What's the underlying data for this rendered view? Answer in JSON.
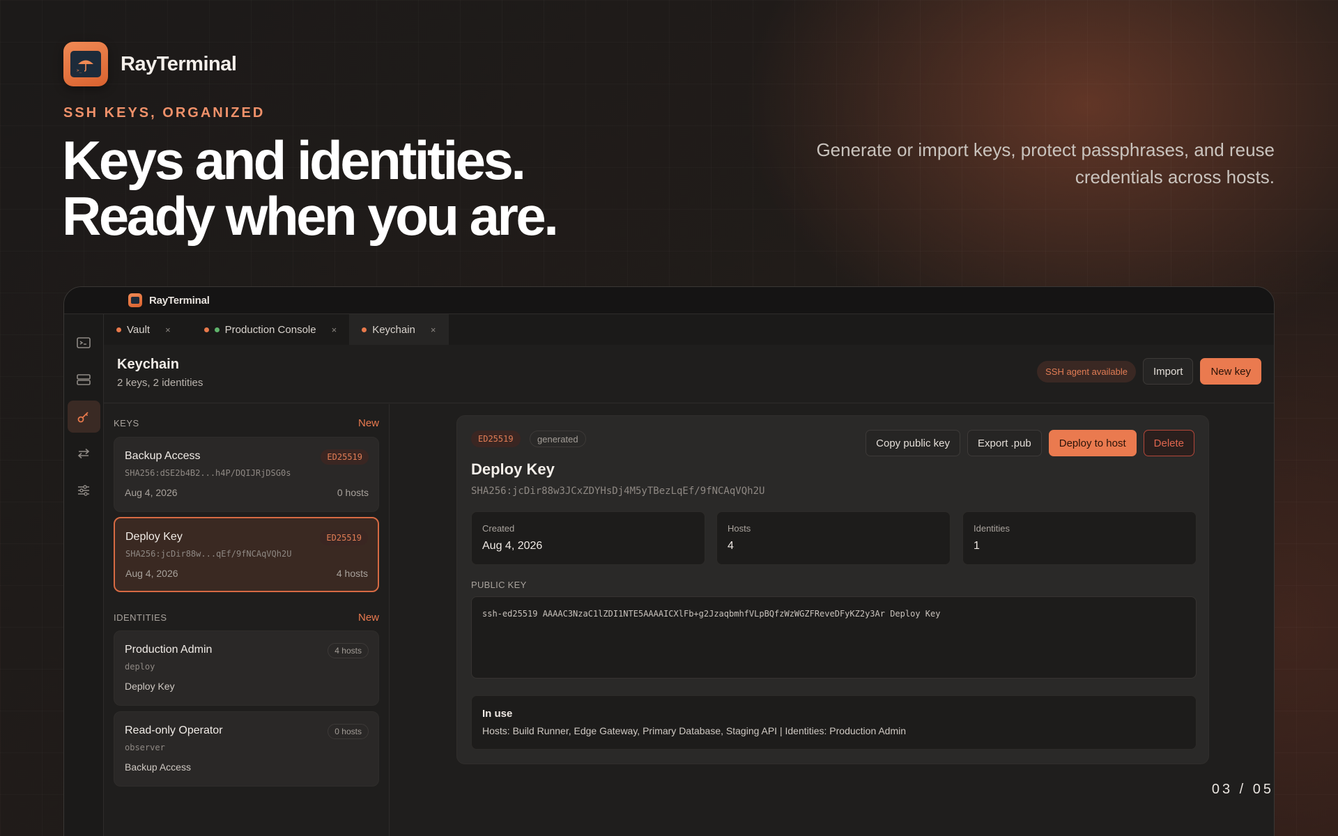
{
  "brand": {
    "name": "RayTerminal"
  },
  "hero": {
    "eyebrow": "SSH KEYS, ORGANIZED",
    "line1": "Keys and identities.",
    "line2": "Ready when you are.",
    "tagline": "Generate or import keys, protect passphrases, and reuse credentials across hosts."
  },
  "pager": "03 / 05",
  "window": {
    "title": "RayTerminal",
    "tabs": [
      {
        "label": "Vault",
        "close": "×"
      },
      {
        "label": "Production Console",
        "close": "×"
      },
      {
        "label": "Keychain",
        "close": "×"
      }
    ],
    "rail": [
      "terminal-icon",
      "server-icon",
      "key-icon",
      "transfer-icon",
      "sliders-icon"
    ]
  },
  "page": {
    "title": "Keychain",
    "subtitle": "2 keys, 2 identities",
    "agent_badge": "SSH agent available",
    "import_label": "Import",
    "new_key_label": "New key"
  },
  "keys_section": {
    "heading": "KEYS",
    "new_label": "New",
    "items": [
      {
        "name": "Backup Access",
        "type": "ED25519",
        "fingerprint": "SHA256:dSE2b4B2...h4P/DQIJRjDSG0s",
        "date": "Aug 4, 2026",
        "hosts": "0 hosts"
      },
      {
        "name": "Deploy Key",
        "type": "ED25519",
        "fingerprint": "SHA256:jcDir88w...qEf/9fNCAqVQh2U",
        "date": "Aug 4, 2026",
        "hosts": "4 hosts"
      }
    ]
  },
  "identities_section": {
    "heading": "IDENTITIES",
    "new_label": "New",
    "items": [
      {
        "name": "Production Admin",
        "user": "deploy",
        "key": "Deploy Key",
        "hosts": "4 hosts"
      },
      {
        "name": "Read-only Operator",
        "user": "observer",
        "key": "Backup Access",
        "hosts": "0 hosts"
      }
    ]
  },
  "detail": {
    "algorithm": "ED25519",
    "origin": "generated",
    "copy_label": "Copy public key",
    "export_label": "Export .pub",
    "deploy_label": "Deploy to host",
    "delete_label": "Delete",
    "title": "Deploy Key",
    "fingerprint": "SHA256:jcDir88w3JCxZDYHsDj4M5yTBezLqEf/9fNCAqVQh2U",
    "stats": [
      {
        "label": "Created",
        "value": "Aug 4, 2026"
      },
      {
        "label": "Hosts",
        "value": "4"
      },
      {
        "label": "Identities",
        "value": "1"
      }
    ],
    "public_key_label": "PUBLIC KEY",
    "public_key": "ssh-ed25519 AAAAC3NzaC1lZDI1NTE5AAAAICXlFb+g2JzaqbmhfVLpBQfzWzWGZFReveDFyKZ2y3Ar Deploy Key",
    "in_use_title": "In use",
    "in_use_detail": "Hosts: Build Runner, Edge Gateway, Primary Database, Staging API | Identities: Production Admin"
  },
  "colors": {
    "accent": "#ea7a4f",
    "background": "#1c1a19",
    "panel": "#2a2928"
  }
}
